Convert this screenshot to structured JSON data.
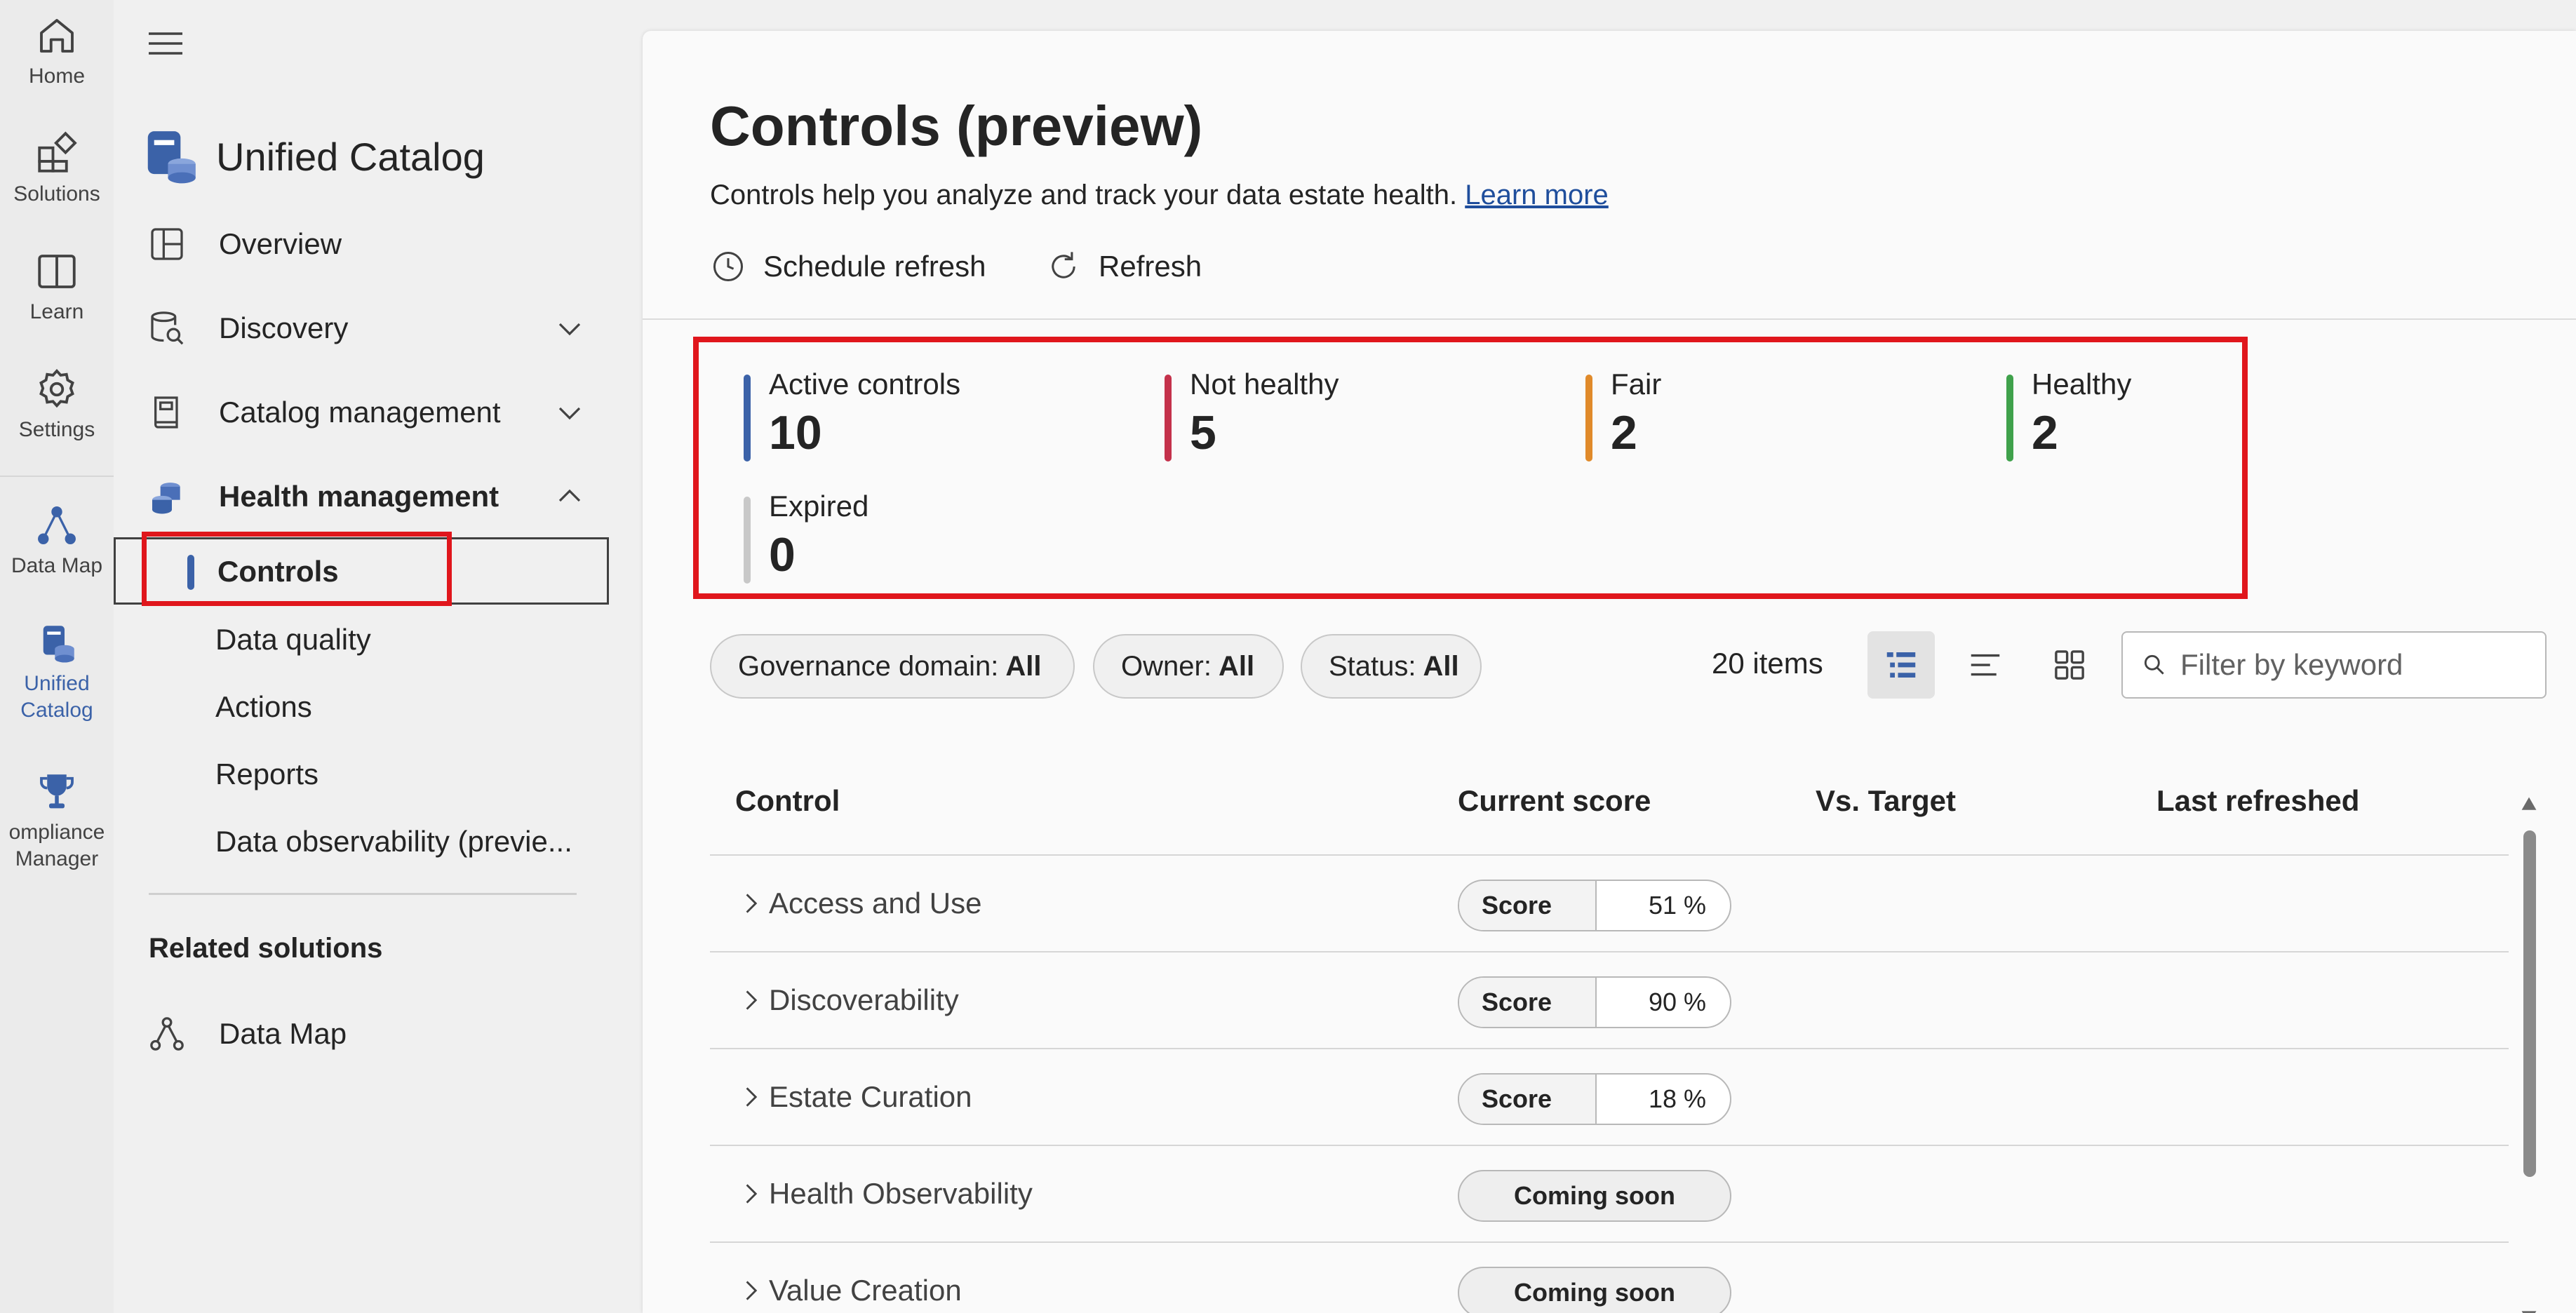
{
  "rail": {
    "items": [
      {
        "label": "Home",
        "icon": "home-icon"
      },
      {
        "label": "Solutions",
        "icon": "solutions-icon"
      },
      {
        "label": "Learn",
        "icon": "book-icon"
      },
      {
        "label": "Settings",
        "icon": "gear-icon"
      },
      {
        "label": "Data Map",
        "icon": "data-map-icon"
      },
      {
        "label": "Unified Catalog",
        "icon": "unified-catalog-icon"
      },
      {
        "label": "ompliance Manager",
        "icon": "trophy-icon"
      }
    ]
  },
  "nav": {
    "title": "Unified Catalog",
    "items": [
      {
        "label": "Overview"
      },
      {
        "label": "Discovery"
      },
      {
        "label": "Catalog management"
      },
      {
        "label": "Health management"
      }
    ],
    "subitems": [
      {
        "label": "Controls",
        "selected": true
      },
      {
        "label": "Data quality"
      },
      {
        "label": "Actions"
      },
      {
        "label": "Reports"
      },
      {
        "label": "Data observability (previe..."
      }
    ],
    "related_heading": "Related solutions",
    "related_items": [
      {
        "label": "Data Map"
      }
    ]
  },
  "main": {
    "title": "Controls (preview)",
    "subtitle": "Controls help you analyze and track your data estate health.",
    "learn_more": "Learn more",
    "toolbar": {
      "schedule_refresh": "Schedule refresh",
      "refresh": "Refresh"
    },
    "stats": [
      {
        "label": "Active controls",
        "value": "10",
        "color": "#3b62a8"
      },
      {
        "label": "Not healthy",
        "value": "5",
        "color": "#c4314b"
      },
      {
        "label": "Fair",
        "value": "2",
        "color": "#e08a2a"
      },
      {
        "label": "Healthy",
        "value": "2",
        "color": "#3fa14b"
      },
      {
        "label": "Expired",
        "value": "0",
        "color": "#c8c8c8"
      }
    ],
    "filters": [
      {
        "label": "Governance domain:",
        "value": "All"
      },
      {
        "label": "Owner:",
        "value": "All"
      },
      {
        "label": "Status:",
        "value": "All"
      }
    ],
    "items_count": "20 items",
    "search": {
      "placeholder": "Filter by keyword",
      "value": ""
    },
    "table": {
      "columns": [
        "Control",
        "Current score",
        "Vs. Target",
        "Last refreshed"
      ],
      "rows": [
        {
          "name": "Access and Use",
          "score_label": "Score",
          "score": "51 %",
          "score_value": 0.51
        },
        {
          "name": "Discoverability",
          "score_label": "Score",
          "score": "90 %",
          "score_value": 0.9
        },
        {
          "name": "Estate Curation",
          "score_label": "Score",
          "score": "18 %",
          "score_value": 0.18
        },
        {
          "name": "Health Observability",
          "status": "Coming soon"
        },
        {
          "name": "Value Creation",
          "status": "Coming soon"
        }
      ]
    }
  }
}
